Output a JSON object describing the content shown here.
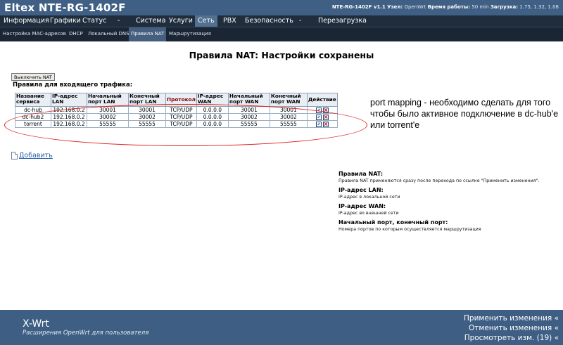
{
  "header": {
    "brand": "Eltex NTE-RG-1402F",
    "info_model": "NTE-RG-1402F v1.1",
    "info_node_label": "Узел:",
    "info_node_value": "OpenWrt",
    "info_uptime_label": "Время работы:",
    "info_uptime_value": "50 min",
    "info_load_label": "Загрузка:",
    "info_load_value": "1.75, 1.32, 1.08"
  },
  "main_menu": [
    {
      "label": "Информация"
    },
    {
      "label": "Графики"
    },
    {
      "label": "Статус"
    },
    {
      "label": "-"
    },
    {
      "label": "Система"
    },
    {
      "label": "Услуги"
    },
    {
      "label": "Сеть"
    },
    {
      "label": "PBX"
    },
    {
      "label": "Безопасность"
    },
    {
      "label": "-"
    },
    {
      "label": "Перезагрузка"
    }
  ],
  "sub_menu": [
    {
      "label": "Настройка MAC-адресов"
    },
    {
      "label": "DHCP"
    },
    {
      "label": "Локальный DNS"
    },
    {
      "label": "Правила NAT"
    },
    {
      "label": "Маршрутизация"
    }
  ],
  "page_title": "Правила NAT: Настройки сохранены",
  "disable_button": "Выключить NAT",
  "inbound_title": "Правила для входящего трафика:",
  "table": {
    "headers": [
      "Название сервиса",
      "IP-адрес LAN",
      "Начальный порт LAN",
      "Конечный порт LAN",
      "Протокол",
      "IP-адрес WAN",
      "Начальный порт WAN",
      "Конечный порт WAN",
      "Действие"
    ],
    "rows": [
      [
        "dc-hub",
        "192.168.0.2",
        "30001",
        "30001",
        "TCP/UDP",
        "0.0.0.0",
        "30001",
        "30001"
      ],
      [
        "dc-hub2",
        "192.168.0.2",
        "30002",
        "30002",
        "TCP/UDP",
        "0.0.0.0",
        "30002",
        "30002"
      ],
      [
        "torrent",
        "192.168.0.2",
        "55555",
        "55555",
        "TCP/UDP",
        "0.0.0.0",
        "55555",
        "55555"
      ]
    ]
  },
  "annotation": "port mapping - необходимо сделать для того чтобы было активное подключение в dc-hub'e или torrent'e",
  "add_link": "Добавить",
  "help": [
    {
      "title": "Правила NAT:",
      "text": "Правила NAT применяются сразу после перехода по ссылке \"Применить изменения\"."
    },
    {
      "title": "IP-адрес LAN:",
      "text": "IP-адрес в локальной сети"
    },
    {
      "title": "IP-адрес WAN:",
      "text": "IP-адрес во внешней сети"
    },
    {
      "title": "Начальный порт, конечный порт:",
      "text": "Номера портов по которым осуществляется маршрутизация"
    }
  ],
  "footer": {
    "title": "X-Wrt",
    "subtitle": "Расширения OpenWrt для пользователя",
    "apply": "Применить изменения «",
    "cancel": "Отменить изменения «",
    "review": "Просмотреть изм. (19) «"
  },
  "colors": {
    "header_bg": "#3f5f84",
    "menu_bg": "#1f2d3d",
    "active_tab": "#52708f",
    "annotation_oval": "#e02020",
    "link": "#2a5ea8"
  }
}
